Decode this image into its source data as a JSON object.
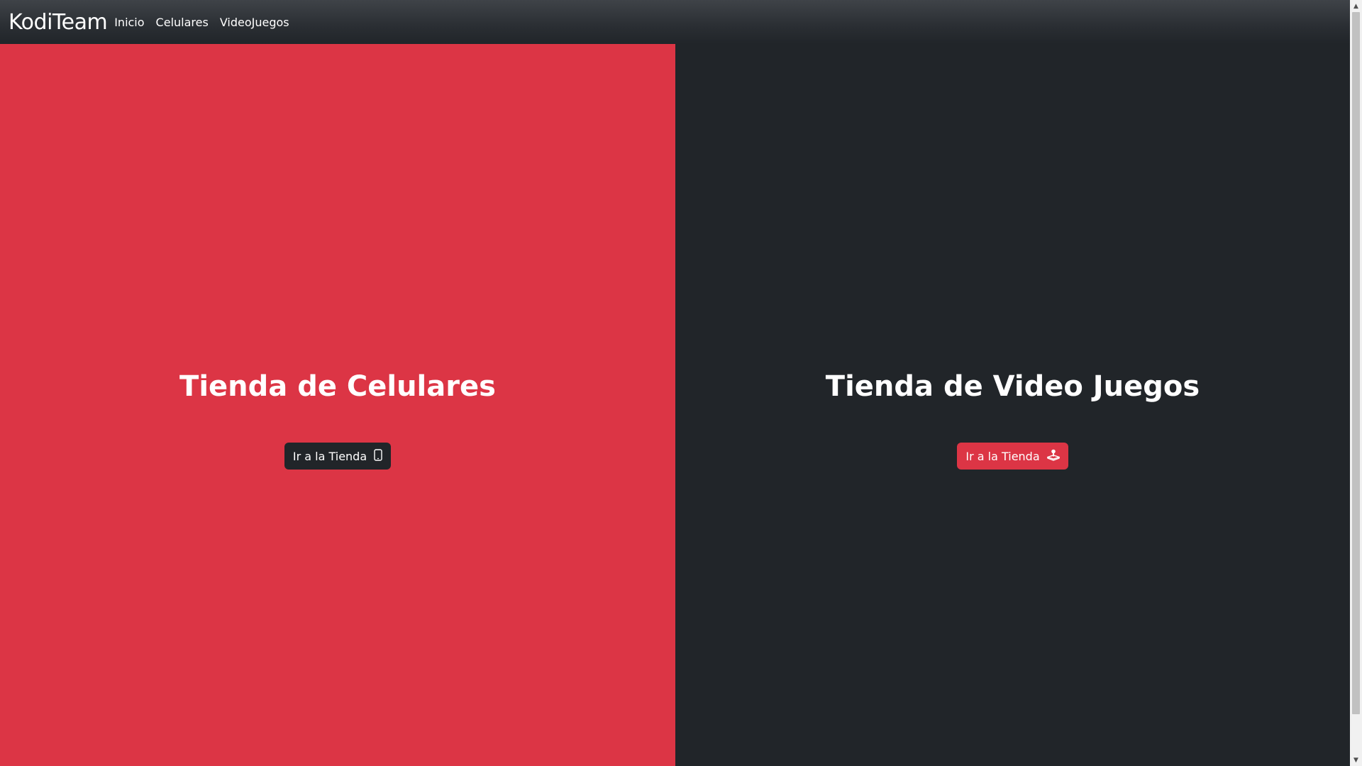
{
  "navbar": {
    "brand": "KodiTeam",
    "links": [
      "Inicio",
      "Celulares",
      "VideoJuegos"
    ]
  },
  "panels": [
    {
      "title": "Tienda de Celulares",
      "button_label": "Ir a la Tienda",
      "button_icon": "phone-icon",
      "background": "#dc3545",
      "button_color": "#212529"
    },
    {
      "title": "Tienda de Video Juegos",
      "button_label": "Ir a la Tienda",
      "button_icon": "joystick-icon",
      "background": "#212529",
      "button_color": "#dc3545"
    }
  ]
}
